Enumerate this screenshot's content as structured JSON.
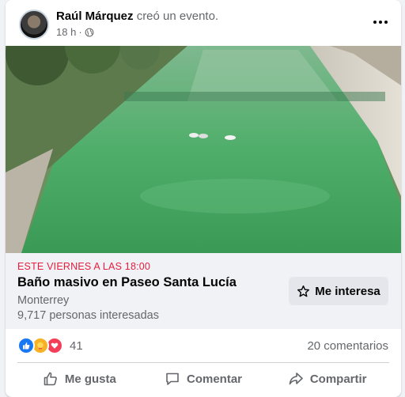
{
  "post": {
    "author": "Raúl Márquez",
    "action": "creó un evento.",
    "time": "18 h",
    "privacy_icon": "globe-icon"
  },
  "event": {
    "date": "ESTE VIERNES A LAS 18:00",
    "title": "Baño masivo en Paseo Santa Lucía",
    "city": "Monterrey",
    "interested": "9,717 personas interesadas",
    "interest_button": "Me interesa"
  },
  "reactions": {
    "count": "41",
    "types": [
      "like-icon",
      "care-icon",
      "love-icon"
    ]
  },
  "comments": "20 comentarios",
  "actions": {
    "like": "Me gusta",
    "comment": "Comentar",
    "share": "Compartir"
  },
  "colors": {
    "event_date": "#e41e3f",
    "secondary_text": "#65676b",
    "like_blue": "#1877f2",
    "love_red": "#f33e58"
  }
}
